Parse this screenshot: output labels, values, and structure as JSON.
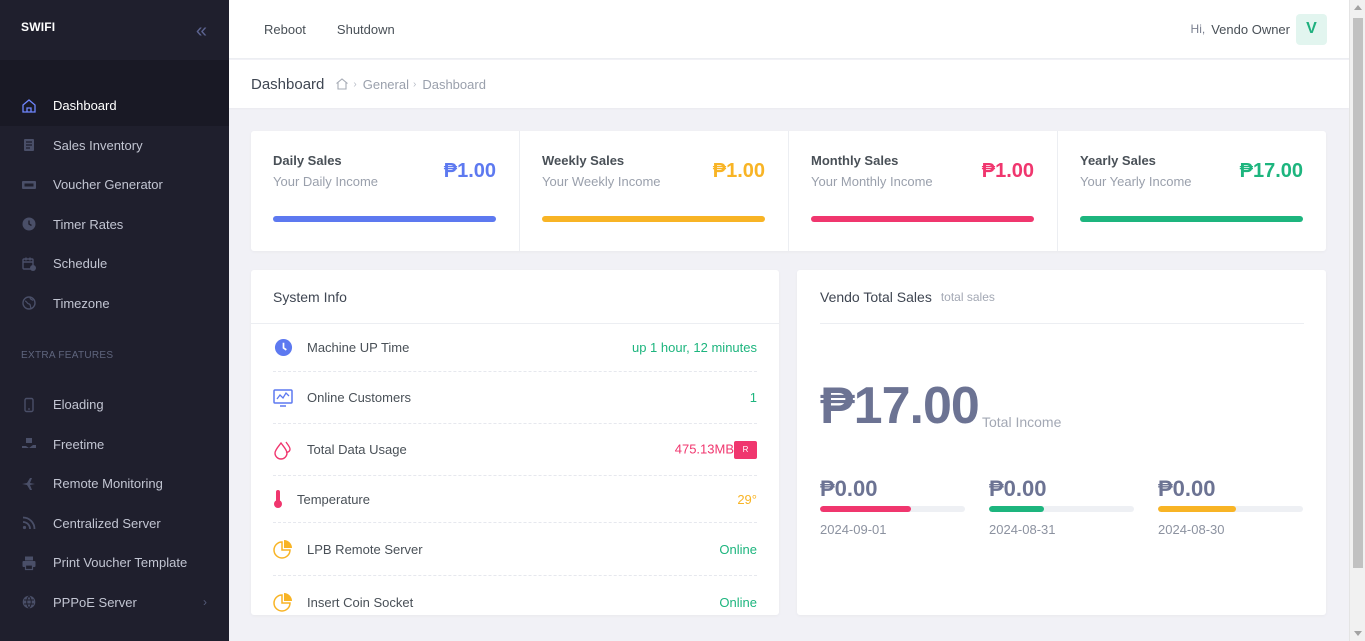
{
  "sidebar": {
    "brand": "SWIFI",
    "items": [
      {
        "label": "Dashboard",
        "icon": "home-icon",
        "active": true
      },
      {
        "label": "Sales Inventory",
        "icon": "inventory-icon"
      },
      {
        "label": "Voucher Generator",
        "icon": "voucher-icon"
      },
      {
        "label": "Timer Rates",
        "icon": "clock-icon"
      },
      {
        "label": "Schedule",
        "icon": "calendar-icon"
      },
      {
        "label": "Timezone",
        "icon": "globe-icon"
      }
    ],
    "section_label": "EXTRA FEATURES",
    "extra_items": [
      {
        "label": "Eloading",
        "icon": "phone-icon"
      },
      {
        "label": "Freetime",
        "icon": "gift-hand-icon"
      },
      {
        "label": "Remote Monitoring",
        "icon": "plane-icon"
      },
      {
        "label": "Centralized Server",
        "icon": "rss-icon"
      },
      {
        "label": "Print Voucher Template",
        "icon": "printer-icon"
      },
      {
        "label": "PPPoE Server",
        "icon": "globe-icon"
      }
    ]
  },
  "topbar": {
    "reboot_label": "Reboot",
    "shutdown_label": "Shutdown",
    "greeting": "Hi,",
    "user_name": "Vendo Owner",
    "avatar_letter": "V"
  },
  "page": {
    "title": "Dashboard",
    "breadcrumb": [
      "General",
      "Dashboard"
    ]
  },
  "stats": [
    {
      "title": "Daily Sales",
      "subtitle": "Your Daily Income",
      "value": "₱1.00",
      "color": "#5d79f0"
    },
    {
      "title": "Weekly Sales",
      "subtitle": "Your Weekly Income",
      "value": "₱1.00",
      "color": "#f8b425"
    },
    {
      "title": "Monthly Sales",
      "subtitle": "Your Monthly Income",
      "value": "₱1.00",
      "color": "#f0366e"
    },
    {
      "title": "Yearly Sales",
      "subtitle": "Your Yearly Income",
      "value": "₱17.00",
      "color": "#1db57e"
    }
  ],
  "system_info": {
    "title": "System Info",
    "rows": [
      {
        "label": "Machine UP Time",
        "value": "up 1 hour, 12 minutes",
        "icon": "clock-icon",
        "color": "#1db57e"
      },
      {
        "label": "Online Customers",
        "value": "1",
        "icon": "monitor-chart-icon",
        "color": "#1db57e"
      },
      {
        "label": "Total Data Usage",
        "value": "475.13MB",
        "badge": "R",
        "icon": "drops-icon",
        "color": "#f0366e"
      },
      {
        "label": "Temperature",
        "value": "29°",
        "icon": "thermometer-icon",
        "color": "#f8b425"
      },
      {
        "label": "LPB Remote Server",
        "value": "Online",
        "icon": "pie-chart-icon",
        "color": "#1db57e"
      },
      {
        "label": "Insert Coin Socket",
        "value": "Online",
        "icon": "pie-chart-icon",
        "color": "#1db57e"
      }
    ]
  },
  "vendo": {
    "title": "Vendo Total Sales",
    "subtitle": "total sales",
    "total": "₱17.00",
    "total_label": "Total Income",
    "days": [
      {
        "value": "₱0.00",
        "date": "2024-09-01",
        "progress": 0.63,
        "color": "#f0366e"
      },
      {
        "value": "₱0.00",
        "date": "2024-08-31",
        "progress": 0.38,
        "color": "#1db57e"
      },
      {
        "value": "₱0.00",
        "date": "2024-08-30",
        "progress": 0.54,
        "color": "#f8b425"
      }
    ]
  }
}
